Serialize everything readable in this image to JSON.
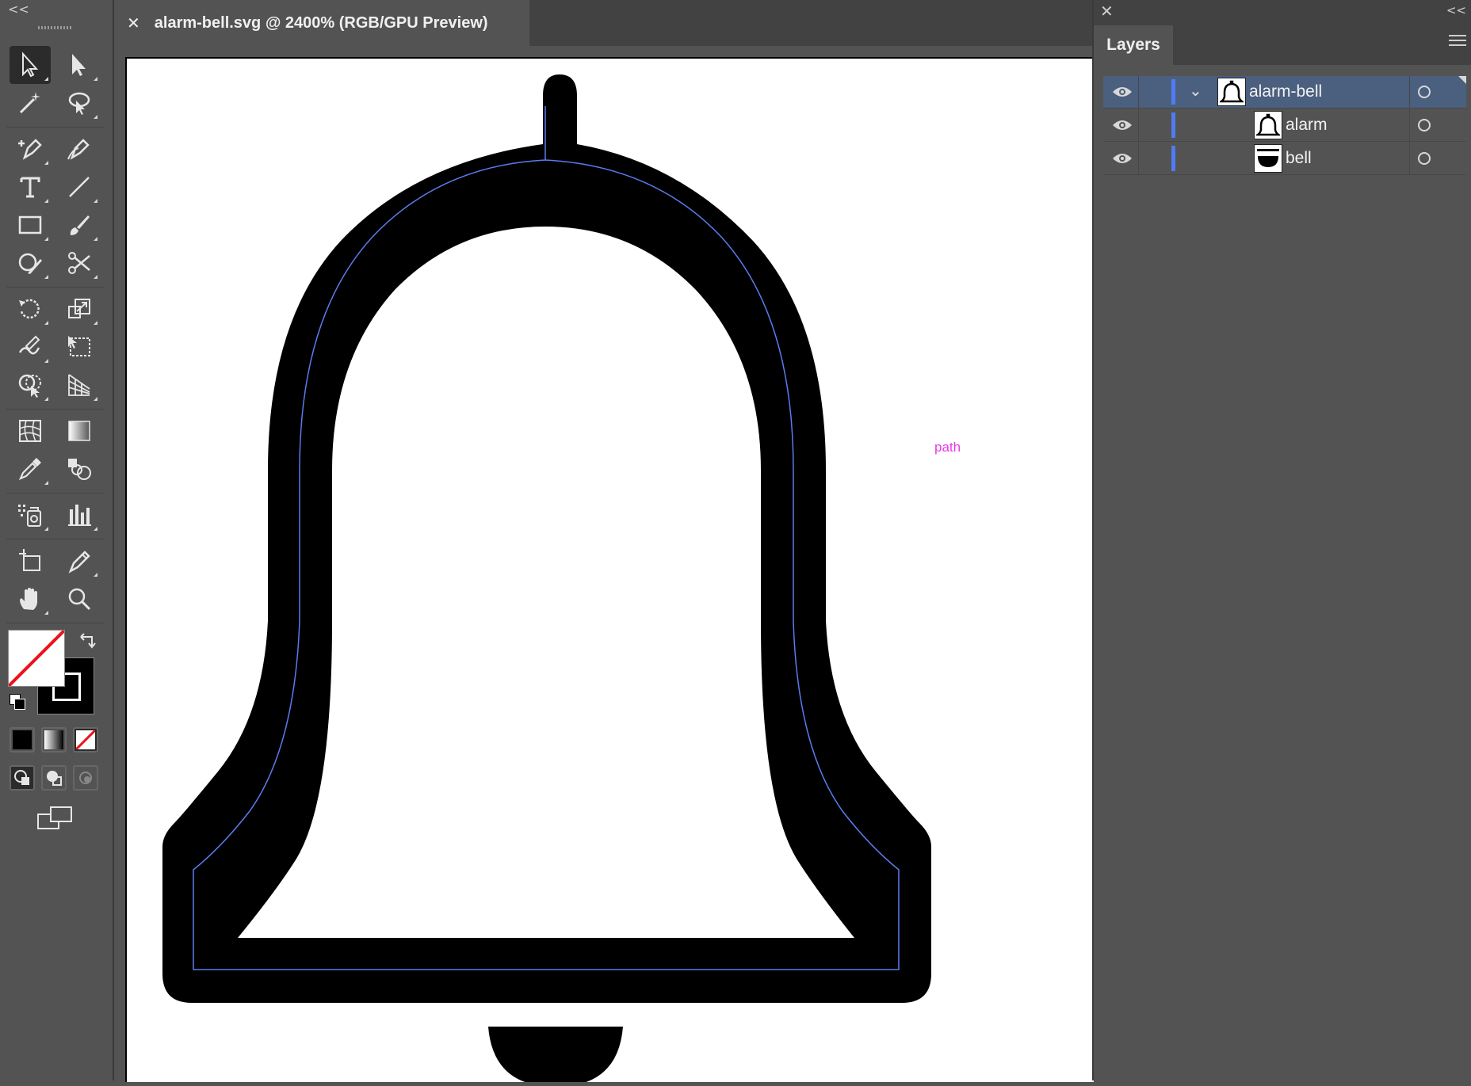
{
  "document": {
    "tab_title": "alarm-bell.svg @ 2400% (RGB/GPU Preview)",
    "close_symbol": "✕"
  },
  "toolbox": {
    "collapse_symbol": "<<",
    "tools": [
      {
        "name": "selection-tool",
        "icon": "arrow-icon",
        "active": true
      },
      {
        "name": "direct-selection-tool",
        "icon": "direct-arrow-icon"
      },
      {
        "name": "magic-wand-tool",
        "icon": "magic-wand-icon"
      },
      {
        "name": "lasso-tool",
        "icon": "lasso-icon"
      },
      {
        "name": "pen-tool",
        "icon": "pen-icon"
      },
      {
        "name": "curvature-tool",
        "icon": "curvature-icon"
      },
      {
        "name": "type-tool",
        "icon": "type-icon",
        "glyph": "T"
      },
      {
        "name": "line-segment-tool",
        "icon": "line-icon"
      },
      {
        "name": "rectangle-tool",
        "icon": "rectangle-icon"
      },
      {
        "name": "paintbrush-tool",
        "icon": "paintbrush-icon"
      },
      {
        "name": "shaper-tool",
        "icon": "shaper-icon"
      },
      {
        "name": "scissors-tool",
        "icon": "scissors-icon"
      },
      {
        "name": "rotate-tool",
        "icon": "rotate-icon"
      },
      {
        "name": "scale-tool",
        "icon": "scale-icon"
      },
      {
        "name": "warp-tool",
        "icon": "warp-icon"
      },
      {
        "name": "free-transform-tool",
        "icon": "free-transform-icon"
      },
      {
        "name": "shape-builder-tool",
        "icon": "shape-builder-icon"
      },
      {
        "name": "perspective-grid-tool",
        "icon": "perspective-grid-icon"
      },
      {
        "name": "mesh-tool",
        "icon": "mesh-icon"
      },
      {
        "name": "gradient-tool",
        "icon": "gradient-icon"
      },
      {
        "name": "eyedropper-tool",
        "icon": "eyedropper-icon"
      },
      {
        "name": "blend-tool",
        "icon": "blend-icon"
      },
      {
        "name": "symbol-sprayer-tool",
        "icon": "symbol-sprayer-icon"
      },
      {
        "name": "column-graph-tool",
        "icon": "column-graph-icon"
      },
      {
        "name": "artboard-tool",
        "icon": "artboard-icon"
      },
      {
        "name": "slice-tool",
        "icon": "slice-icon"
      },
      {
        "name": "hand-tool",
        "icon": "hand-icon"
      },
      {
        "name": "zoom-tool",
        "icon": "zoom-icon"
      }
    ],
    "fill_color": "#ffffff",
    "stroke_color": "#000000",
    "none_indicator_color": "#e8141b"
  },
  "canvas": {
    "path_hint_label": "path",
    "path_hint_color": "#e83ae8",
    "selection_outline_color": "#5a7cf0"
  },
  "layers_panel": {
    "close_symbol": "✕",
    "collapse_symbol": "<<",
    "tab_label": "Layers",
    "layers": [
      {
        "name": "alarm-bell",
        "visible": true,
        "expanded": true,
        "selected": true,
        "level": 0,
        "thumb": "bell-outline-icon"
      },
      {
        "name": "alarm",
        "visible": true,
        "selected": false,
        "level": 1,
        "thumb": "bell-outline-icon"
      },
      {
        "name": "bell",
        "visible": true,
        "selected": false,
        "level": 1,
        "thumb": "half-circle-icon"
      }
    ],
    "layer_color": "#4f7cf5"
  }
}
